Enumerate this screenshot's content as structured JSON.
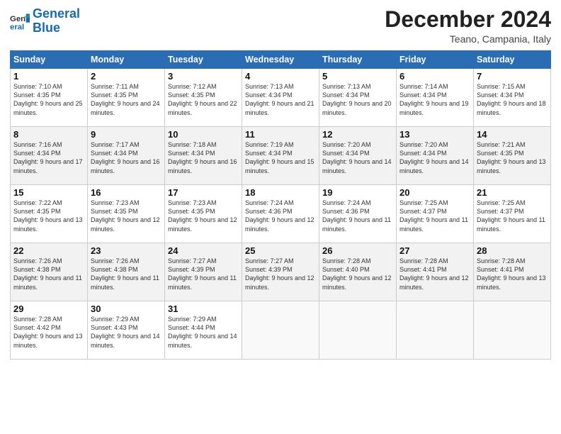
{
  "logo": {
    "line1": "General",
    "line2": "Blue"
  },
  "title": "December 2024",
  "location": "Teano, Campania, Italy",
  "days_of_week": [
    "Sunday",
    "Monday",
    "Tuesday",
    "Wednesday",
    "Thursday",
    "Friday",
    "Saturday"
  ],
  "weeks": [
    [
      {
        "day": "1",
        "sunrise": "7:10 AM",
        "sunset": "4:35 PM",
        "daylight": "9 hours and 25 minutes."
      },
      {
        "day": "2",
        "sunrise": "7:11 AM",
        "sunset": "4:35 PM",
        "daylight": "9 hours and 24 minutes."
      },
      {
        "day": "3",
        "sunrise": "7:12 AM",
        "sunset": "4:35 PM",
        "daylight": "9 hours and 22 minutes."
      },
      {
        "day": "4",
        "sunrise": "7:13 AM",
        "sunset": "4:34 PM",
        "daylight": "9 hours and 21 minutes."
      },
      {
        "day": "5",
        "sunrise": "7:13 AM",
        "sunset": "4:34 PM",
        "daylight": "9 hours and 20 minutes."
      },
      {
        "day": "6",
        "sunrise": "7:14 AM",
        "sunset": "4:34 PM",
        "daylight": "9 hours and 19 minutes."
      },
      {
        "day": "7",
        "sunrise": "7:15 AM",
        "sunset": "4:34 PM",
        "daylight": "9 hours and 18 minutes."
      }
    ],
    [
      {
        "day": "8",
        "sunrise": "7:16 AM",
        "sunset": "4:34 PM",
        "daylight": "9 hours and 17 minutes."
      },
      {
        "day": "9",
        "sunrise": "7:17 AM",
        "sunset": "4:34 PM",
        "daylight": "9 hours and 16 minutes."
      },
      {
        "day": "10",
        "sunrise": "7:18 AM",
        "sunset": "4:34 PM",
        "daylight": "9 hours and 16 minutes."
      },
      {
        "day": "11",
        "sunrise": "7:19 AM",
        "sunset": "4:34 PM",
        "daylight": "9 hours and 15 minutes."
      },
      {
        "day": "12",
        "sunrise": "7:20 AM",
        "sunset": "4:34 PM",
        "daylight": "9 hours and 14 minutes."
      },
      {
        "day": "13",
        "sunrise": "7:20 AM",
        "sunset": "4:34 PM",
        "daylight": "9 hours and 14 minutes."
      },
      {
        "day": "14",
        "sunrise": "7:21 AM",
        "sunset": "4:35 PM",
        "daylight": "9 hours and 13 minutes."
      }
    ],
    [
      {
        "day": "15",
        "sunrise": "7:22 AM",
        "sunset": "4:35 PM",
        "daylight": "9 hours and 13 minutes."
      },
      {
        "day": "16",
        "sunrise": "7:23 AM",
        "sunset": "4:35 PM",
        "daylight": "9 hours and 12 minutes."
      },
      {
        "day": "17",
        "sunrise": "7:23 AM",
        "sunset": "4:35 PM",
        "daylight": "9 hours and 12 minutes."
      },
      {
        "day": "18",
        "sunrise": "7:24 AM",
        "sunset": "4:36 PM",
        "daylight": "9 hours and 12 minutes."
      },
      {
        "day": "19",
        "sunrise": "7:24 AM",
        "sunset": "4:36 PM",
        "daylight": "9 hours and 11 minutes."
      },
      {
        "day": "20",
        "sunrise": "7:25 AM",
        "sunset": "4:37 PM",
        "daylight": "9 hours and 11 minutes."
      },
      {
        "day": "21",
        "sunrise": "7:25 AM",
        "sunset": "4:37 PM",
        "daylight": "9 hours and 11 minutes."
      }
    ],
    [
      {
        "day": "22",
        "sunrise": "7:26 AM",
        "sunset": "4:38 PM",
        "daylight": "9 hours and 11 minutes."
      },
      {
        "day": "23",
        "sunrise": "7:26 AM",
        "sunset": "4:38 PM",
        "daylight": "9 hours and 11 minutes."
      },
      {
        "day": "24",
        "sunrise": "7:27 AM",
        "sunset": "4:39 PM",
        "daylight": "9 hours and 11 minutes."
      },
      {
        "day": "25",
        "sunrise": "7:27 AM",
        "sunset": "4:39 PM",
        "daylight": "9 hours and 12 minutes."
      },
      {
        "day": "26",
        "sunrise": "7:28 AM",
        "sunset": "4:40 PM",
        "daylight": "9 hours and 12 minutes."
      },
      {
        "day": "27",
        "sunrise": "7:28 AM",
        "sunset": "4:41 PM",
        "daylight": "9 hours and 12 minutes."
      },
      {
        "day": "28",
        "sunrise": "7:28 AM",
        "sunset": "4:41 PM",
        "daylight": "9 hours and 13 minutes."
      }
    ],
    [
      {
        "day": "29",
        "sunrise": "7:28 AM",
        "sunset": "4:42 PM",
        "daylight": "9 hours and 13 minutes."
      },
      {
        "day": "30",
        "sunrise": "7:29 AM",
        "sunset": "4:43 PM",
        "daylight": "9 hours and 14 minutes."
      },
      {
        "day": "31",
        "sunrise": "7:29 AM",
        "sunset": "4:44 PM",
        "daylight": "9 hours and 14 minutes."
      },
      null,
      null,
      null,
      null
    ]
  ],
  "labels": {
    "sunrise": "Sunrise:",
    "sunset": "Sunset:",
    "daylight": "Daylight:"
  }
}
